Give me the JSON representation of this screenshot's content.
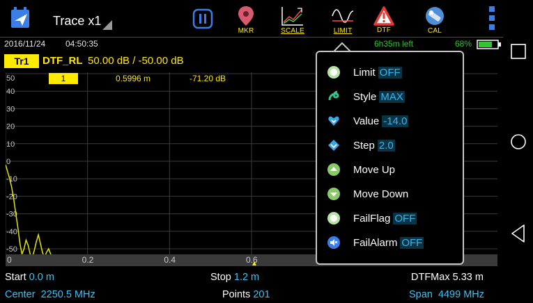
{
  "toolbar": {
    "trace_label": "Trace x1",
    "buttons": [
      {
        "caption": ""
      },
      {
        "caption": "MKR"
      },
      {
        "caption": "SCALE"
      },
      {
        "caption": "LIMIT"
      },
      {
        "caption": "DTF"
      },
      {
        "caption": "CAL"
      }
    ],
    "icons": {
      "app": "bell-icon",
      "pause": "pause-icon",
      "mkr": "map-pin-icon",
      "scale": "scale-chart-icon",
      "limit": "limit-wave-icon",
      "dtf": "warning-triangle-icon",
      "cal": "calibration-icon",
      "more": "more-vertical-icon"
    }
  },
  "status": {
    "date": "2016/11/24",
    "time": "04:50:35",
    "time_left": "6h35m left",
    "battery": "68%"
  },
  "trace": {
    "badge": "Tr1",
    "name": "DTF_RL",
    "scale": "50.00 dB / -50.00 dB"
  },
  "marker": {
    "number": "1",
    "x": "0.5996 m",
    "y": "-71.20 dB"
  },
  "chart_data": {
    "type": "line",
    "xlim": [
      0,
      1.2
    ],
    "ylim": [
      -55,
      50
    ],
    "x_ticks": [
      "0",
      "0.2",
      "0.4",
      "0.6"
    ],
    "y_ticks": [
      "50",
      "40",
      "30",
      "20",
      "10",
      "0",
      "-10",
      "-20",
      "-30",
      "-40",
      "-50"
    ],
    "series": [
      {
        "color": "#e6e600",
        "x": [
          0.0,
          0.005,
          0.01,
          0.015,
          0.02,
          0.025,
          0.03,
          0.035,
          0.04,
          0.045,
          0.05,
          0.055,
          0.06,
          0.065,
          0.07,
          0.075,
          0.08,
          0.085,
          0.09,
          0.095,
          0.1,
          0.105,
          0.11,
          0.115,
          0.12,
          0.125,
          0.13,
          0.135,
          0.14,
          0.15
        ],
        "y": [
          -2,
          -6,
          -10,
          -15,
          -22,
          -30,
          -38,
          -47,
          -53,
          -50,
          -45,
          -48,
          -53,
          -55,
          -51,
          -46,
          -42,
          -47,
          -52,
          -55,
          -52,
          -50,
          -53,
          -55,
          -55,
          -55,
          -55,
          -55,
          -55,
          -55
        ]
      }
    ]
  },
  "bottom": {
    "start_label": "Start",
    "start_value": "0.0 m",
    "stop_label": "Stop",
    "stop_value": "1.2 m",
    "dtfmax": "DTFMax 5.33 m",
    "center_label": "Center",
    "center_value": "2250.5 MHz",
    "points_label": "Points",
    "points_value": "201",
    "span_label": "Span",
    "span_value": "4499 MHz"
  },
  "limit_menu": {
    "items": [
      {
        "label": "Limit",
        "value": "OFF",
        "icon": "toggle-dot-icon"
      },
      {
        "label": "Style",
        "value": "MAX",
        "icon": "style-swirl-icon"
      },
      {
        "label": "Value",
        "value": "-14.0",
        "icon": "value-heart-icon"
      },
      {
        "label": "Step",
        "value": "2.0",
        "icon": "step-diamond-icon"
      },
      {
        "label": "Move Up",
        "value": "",
        "icon": "arrow-up-icon"
      },
      {
        "label": "Move Down",
        "value": "",
        "icon": "arrow-down-icon"
      },
      {
        "label": "FailFlag",
        "value": "OFF",
        "icon": "toggle-dot-icon"
      },
      {
        "label": "FailAlarm",
        "value": "OFF",
        "icon": "speaker-mute-icon"
      }
    ]
  },
  "colors": {
    "accent_yellow": "#ffea00",
    "value_cyan": "#3fc3f3",
    "status_green": "#2ec72e"
  }
}
